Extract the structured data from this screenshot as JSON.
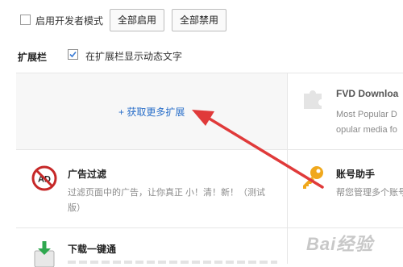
{
  "toolbar": {
    "dev_mode_label": "启用开发者模式",
    "enable_all": "全部启用",
    "disable_all": "全部禁用"
  },
  "ext_bar": {
    "heading": "扩展栏",
    "show_text_label": "在扩展栏显示动态文字"
  },
  "get_more": "+ 获取更多扩展",
  "extensions": [
    {
      "title": "FVD Downloa",
      "desc_lines": [
        "Most Popular D",
        "opular media fo"
      ]
    },
    {
      "title": "广告过滤",
      "desc_lines": [
        "过滤页面中的广告，让你真正 小！清！新！（测试",
        "版）"
      ]
    },
    {
      "title": "账号助手",
      "desc_lines": [
        "帮您管理多个账号"
      ]
    },
    {
      "title": "下载一键通",
      "desc_lines": []
    }
  ],
  "icons": {
    "adblock_icon": "AD",
    "adblock_color": "#c62828",
    "key_color": "#f0a81c",
    "arrow_color": "#e03a3a"
  },
  "watermark": "Bai经验"
}
